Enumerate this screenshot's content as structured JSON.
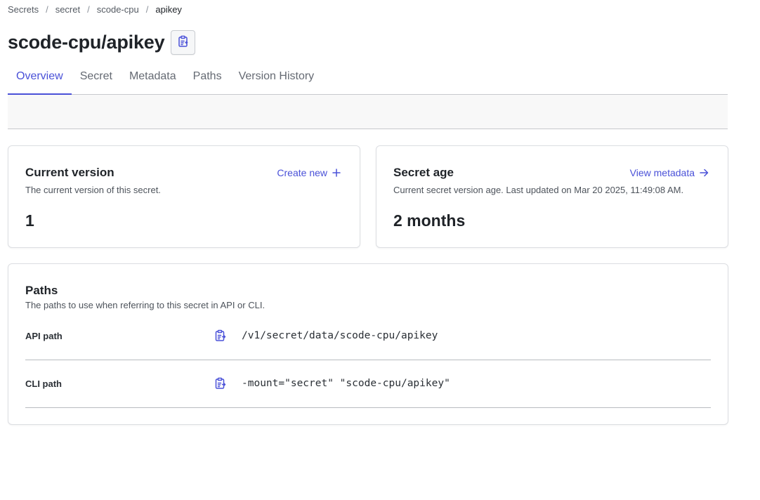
{
  "breadcrumb": [
    {
      "label": "Secrets",
      "current": false
    },
    {
      "label": "secret",
      "current": false
    },
    {
      "label": "scode-cpu",
      "current": false
    },
    {
      "label": "apikey",
      "current": true
    }
  ],
  "breadcrumb_separator": "/",
  "page": {
    "title": "scode-cpu/apikey",
    "copy_icon": "clipboard-icon"
  },
  "tabs": [
    {
      "label": "Overview",
      "active": true
    },
    {
      "label": "Secret",
      "active": false
    },
    {
      "label": "Metadata",
      "active": false
    },
    {
      "label": "Paths",
      "active": false
    },
    {
      "label": "Version History",
      "active": false
    }
  ],
  "current_version": {
    "title": "Current version",
    "description": "The current version of this secret.",
    "value": "1",
    "action_label": "Create new",
    "action_icon": "plus-icon"
  },
  "secret_age": {
    "title": "Secret age",
    "description": "Current secret version age. Last updated on Mar 20 2025, 11:49:08 AM.",
    "value": "2 months",
    "action_label": "View metadata",
    "action_icon": "arrow-right-icon"
  },
  "paths": {
    "title": "Paths",
    "description": "The paths to use when referring to this secret in API or CLI.",
    "rows": [
      {
        "label": "API path",
        "value": "/v1/secret/data/scode-cpu/apikey",
        "copy_icon": "clipboard-icon"
      },
      {
        "label": "CLI path",
        "value": "-mount=\"secret\" \"scode-cpu/apikey\"",
        "copy_icon": "clipboard-icon"
      }
    ]
  },
  "colors": {
    "accent": "#4a51d8",
    "text": "#1f2328",
    "muted": "#656a73",
    "border": "#dcdee2"
  }
}
